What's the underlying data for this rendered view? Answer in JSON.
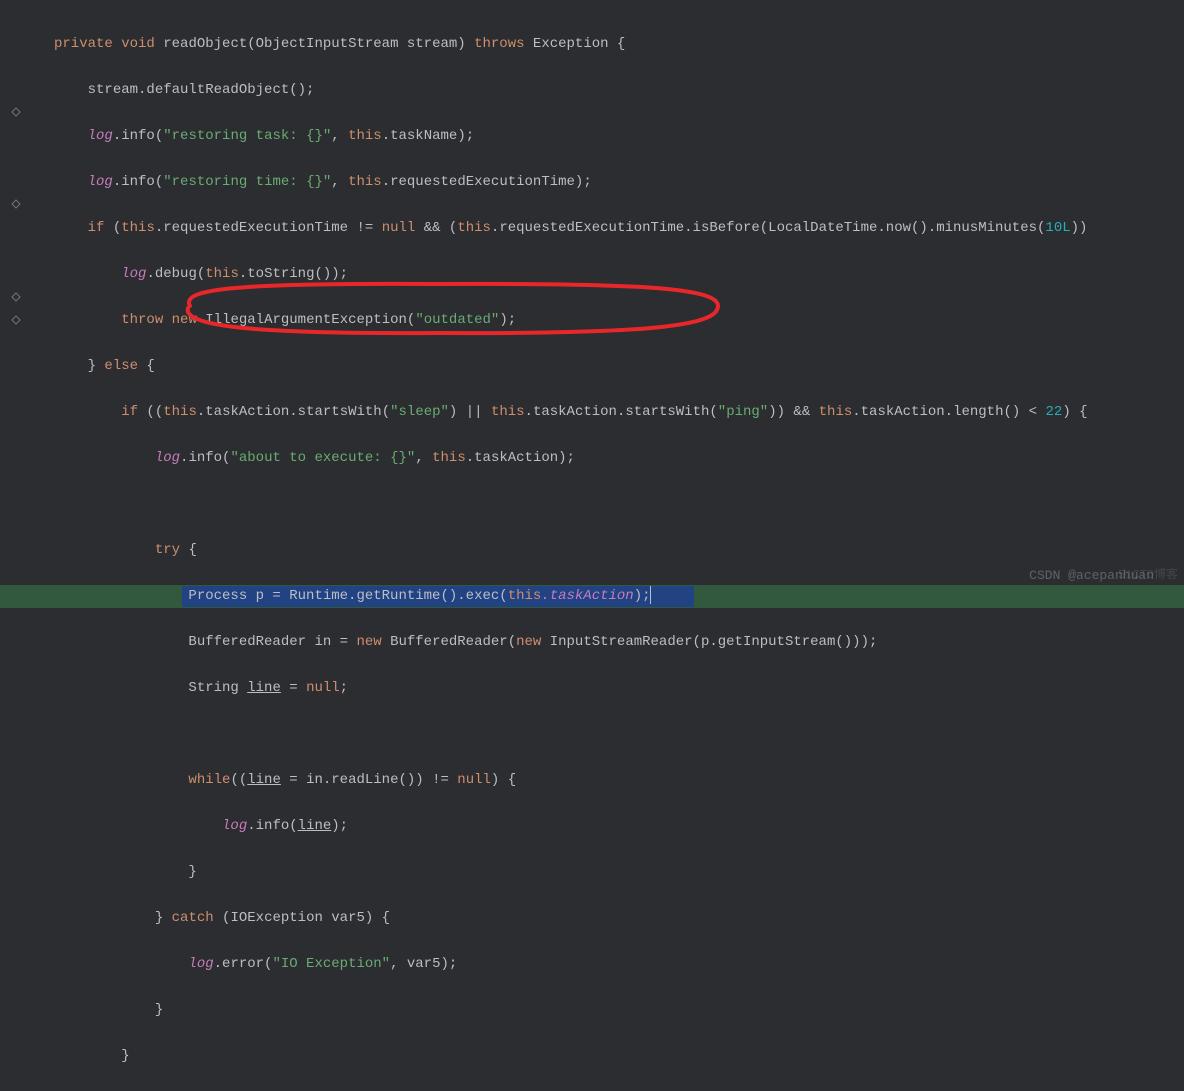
{
  "code": {
    "l1": {
      "kw1": "private",
      "kw2": "void",
      "method": "readObject",
      "param": "(ObjectInputStream stream)",
      "kw3": "throws",
      "exc": "Exception {"
    },
    "l2": {
      "text": "stream.defaultReadObject();"
    },
    "l3": {
      "log": "log",
      "method": ".info(",
      "str": "\"restoring task: {}\"",
      "rest": ", ",
      "kw": "this",
      "rest2": ".taskName);"
    },
    "l4": {
      "log": "log",
      "method": ".info(",
      "str": "\"restoring time: {}\"",
      "rest": ", ",
      "kw": "this",
      "rest2": ".requestedExecutionTime);"
    },
    "l5": {
      "kw1": "if",
      "open": " (",
      "kw2": "this",
      "f1": ".requestedExecutionTime",
      "op": " != ",
      "kw3": "null",
      "op2": " && (",
      "kw4": "this",
      "f2": ".requestedExecutionTime",
      "m1": ".isBefore(LocalDateTime.now().minusMinutes(",
      "num": "10L",
      "close": "))"
    },
    "l6": {
      "log": "log",
      "m": ".debug(",
      "kw": "this",
      "rest": ".toString());"
    },
    "l7": {
      "kw1": "throw",
      "kw2": "new",
      "type": "IllegalArgumentException(",
      "str": "\"outdated\"",
      "close": ");"
    },
    "l8": {
      "close": "} ",
      "kw": "else",
      "open": " {"
    },
    "l9": {
      "kw1": "if",
      "open": " ((",
      "kw2": "this",
      "f1": ".taskAction",
      "m1": ".startsWith(",
      "str1": "\"sleep\"",
      "mid": ") || ",
      "kw3": "this",
      "f2": ".taskAction",
      "m2": ".startsWith(",
      "str2": "\"ping\"",
      "mid2": ")) && ",
      "kw4": "this",
      "f3": ".taskAction",
      "m3": ".length() < ",
      "num": "22",
      "close": ") {"
    },
    "l10": {
      "log": "log",
      "m": ".info(",
      "str": "\"about to execute: {}\"",
      "rest": ", ",
      "kw": "this",
      "rest2": ".taskAction);"
    },
    "l11": {},
    "l12": {
      "kw": "try",
      "open": " {"
    },
    "l13": {
      "type": "Process p = Runtime.getRuntime().exec(",
      "kw": "this",
      "f": ".taskAction",
      "close": ");"
    },
    "l14": {
      "type1": "BufferedReader in = ",
      "kw": "new",
      "type2": " BufferedReader(",
      "kw2": "new",
      "type3": " InputStreamReader(p.getInputStream()));"
    },
    "l15": {
      "type": "String ",
      "u": "line",
      "rest": " = ",
      "kw": "null",
      "close": ";"
    },
    "l16": {},
    "l17": {
      "kw": "while",
      "open": "((",
      "u": "line",
      "rest": " = in.readLine()) != ",
      "kw2": "null",
      "close": ") {"
    },
    "l18": {
      "log": "log",
      "m": ".info(",
      "u": "line",
      "close": ");"
    },
    "l19": {
      "close": "}"
    },
    "l20": {
      "close": "} ",
      "kw": "catch",
      "rest": " (IOException var5) {"
    },
    "l21": {
      "log": "log",
      "m": ".error(",
      "str": "\"IO Exception\"",
      "rest": ", var5);"
    },
    "l22": {
      "close": "}"
    },
    "l23": {
      "close": "}"
    }
  },
  "watermark1": "CSDN @acepanhuan",
  "watermark2": "51CTO博客"
}
